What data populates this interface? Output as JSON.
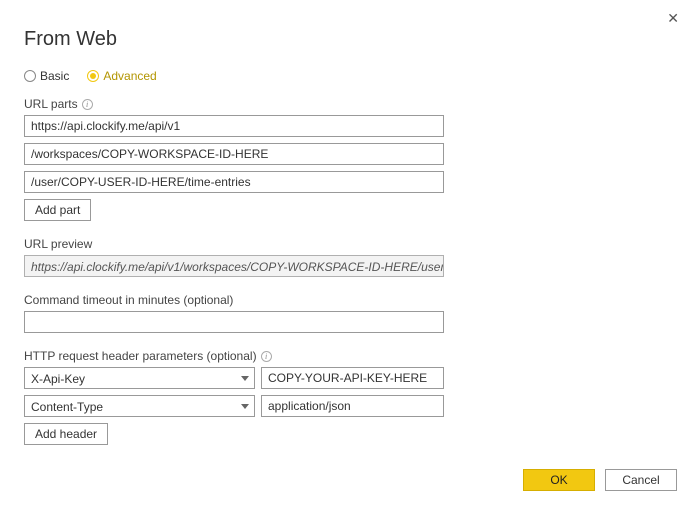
{
  "title": "From Web",
  "mode": {
    "basic_label": "Basic",
    "advanced_label": "Advanced"
  },
  "url_parts": {
    "label": "URL parts",
    "parts": [
      "https://api.clockify.me/api/v1",
      "/workspaces/COPY-WORKSPACE-ID-HERE",
      "/user/COPY-USER-ID-HERE/time-entries"
    ],
    "add_part_label": "Add part"
  },
  "preview": {
    "label": "URL preview",
    "value": "https://api.clockify.me/api/v1/workspaces/COPY-WORKSPACE-ID-HERE/user"
  },
  "timeout": {
    "label": "Command timeout in minutes (optional)",
    "value": ""
  },
  "headers": {
    "label": "HTTP request header parameters (optional)",
    "rows": [
      {
        "key": "X-Api-Key",
        "value": "COPY-YOUR-API-KEY-HERE"
      },
      {
        "key": "Content-Type",
        "value": "application/json"
      }
    ],
    "add_header_label": "Add header"
  },
  "buttons": {
    "ok": "OK",
    "cancel": "Cancel"
  }
}
